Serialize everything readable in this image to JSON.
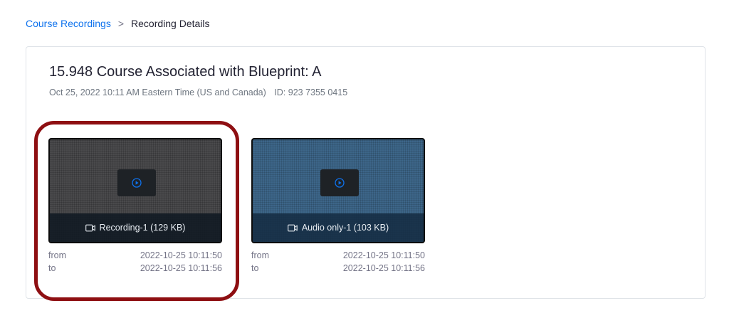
{
  "breadcrumb": {
    "parent": "Course Recordings",
    "separator": ">",
    "current": "Recording Details"
  },
  "meeting": {
    "title": "15.948 Course Associated with Blueprint: A",
    "datetime": "Oct 25, 2022 10:11 AM Eastern Time (US and Canada)",
    "id_label": "ID: 923 7355 0415"
  },
  "recordings": [
    {
      "label": "Recording-1 (129 KB)",
      "from_label": "from",
      "from_value": "2022-10-25 10:11:50",
      "to_label": "to",
      "to_value": "2022-10-25 10:11:56",
      "icon": "play-icon"
    },
    {
      "label": "Audio only-1 (103 KB)",
      "from_label": "from",
      "from_value": "2022-10-25 10:11:50",
      "to_label": "to",
      "to_value": "2022-10-25 10:11:56",
      "icon": "play-icon"
    }
  ],
  "colors": {
    "link": "#0e72ed",
    "highlight": "#8e0f12",
    "play_accent": "#0e72ed"
  }
}
